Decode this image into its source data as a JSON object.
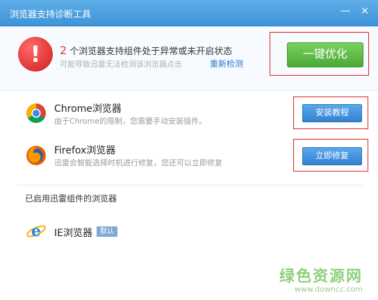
{
  "window": {
    "title": "浏览器支持诊断工具",
    "minimize": "—",
    "close": "×"
  },
  "warning": {
    "count": "2",
    "message": "个浏览器支持组件处于异常或未开启状态",
    "subtext": "可能导致迅雷无法检测该浏览器点击",
    "link": "重新检测",
    "icon_glyph": "!"
  },
  "optimize_button": "一键优化",
  "browsers": [
    {
      "name": "Chrome浏览器",
      "desc": "由于Chrome的限制，您需要手动安装插件。",
      "action": "安装教程"
    },
    {
      "name": "Firefox浏览器",
      "desc": "迅雷会智能选择时机进行修复，您还可以立即修复",
      "action": "立即修复"
    }
  ],
  "enabled_section": {
    "title": "已启用迅雷组件的浏览器",
    "browser": {
      "name": "IE浏览器",
      "badge": "默认"
    }
  },
  "watermark": {
    "text": "绿色资源网",
    "url": "www.downcc.com"
  },
  "colors": {
    "title_bar": "#4a9ee0",
    "accent_blue": "#3a8ad6",
    "accent_green": "#5bbb44",
    "warning_red": "#e03b3b"
  }
}
